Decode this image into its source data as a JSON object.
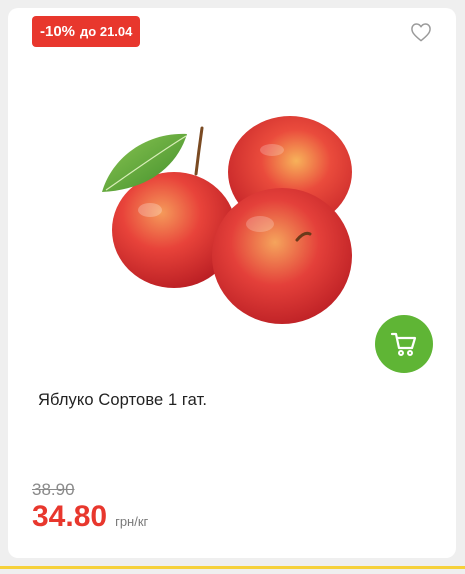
{
  "product": {
    "discount_badge": {
      "percent": "-10%",
      "until": "до 21.04"
    },
    "title": "Яблуко Сортове 1 гат.",
    "old_price": "38.90",
    "price": "34.80",
    "unit": "грн/кг"
  },
  "colors": {
    "badge": "#e8372d",
    "price": "#e8372d",
    "cart_button": "#5fb535",
    "accent_line": "#f6d13a"
  },
  "icons": {
    "favorite": "heart-outline-icon",
    "cart": "shopping-cart-icon"
  }
}
